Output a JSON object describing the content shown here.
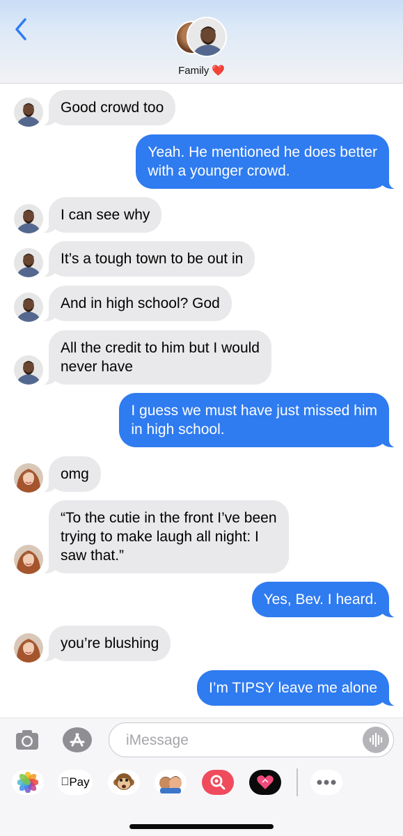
{
  "header": {
    "back_label": "<",
    "group_name": "Family",
    "heart": "❤️"
  },
  "messages": [
    {
      "side": "in",
      "sender": "man",
      "lines": [
        "Good crowd too"
      ]
    },
    {
      "side": "out",
      "lines": [
        "Yeah. He mentioned he does better",
        "with a younger crowd."
      ]
    },
    {
      "side": "in",
      "sender": "man",
      "lines": [
        "I can see why"
      ]
    },
    {
      "side": "in",
      "sender": "man",
      "lines": [
        "It’s a tough town to be out in"
      ]
    },
    {
      "side": "in",
      "sender": "man",
      "lines": [
        "And in high school? God"
      ]
    },
    {
      "side": "in",
      "sender": "man",
      "lines": [
        "All the credit to him but I would",
        "never have"
      ]
    },
    {
      "side": "out",
      "lines": [
        "I guess we must have just missed him",
        "in high school."
      ]
    },
    {
      "side": "in",
      "sender": "woman",
      "lines": [
        "omg"
      ]
    },
    {
      "side": "in",
      "sender": "woman",
      "lines": [
        "“To the cutie in the front I’ve been",
        "trying to make laugh all night: I",
        "saw that.”"
      ]
    },
    {
      "side": "out",
      "lines": [
        "Yes, Bev. I heard."
      ]
    },
    {
      "side": "in",
      "sender": "woman",
      "lines": [
        "you’re blushing"
      ]
    },
    {
      "side": "out",
      "lines": [
        "I’m TIPSY leave me alone"
      ]
    }
  ],
  "compose": {
    "placeholder": "iMessage",
    "apple_pay_label": "Pay"
  },
  "drawer_apps": [
    "photos-icon",
    "apple-pay-icon",
    "monkey-animoji-icon",
    "memoji-icon",
    "search-images-icon",
    "heart-digital-touch-icon",
    "more-icon"
  ],
  "colors": {
    "outgoing": "#2f7bf0",
    "incoming": "#e9e9eb",
    "link": "#2f7bf0"
  }
}
